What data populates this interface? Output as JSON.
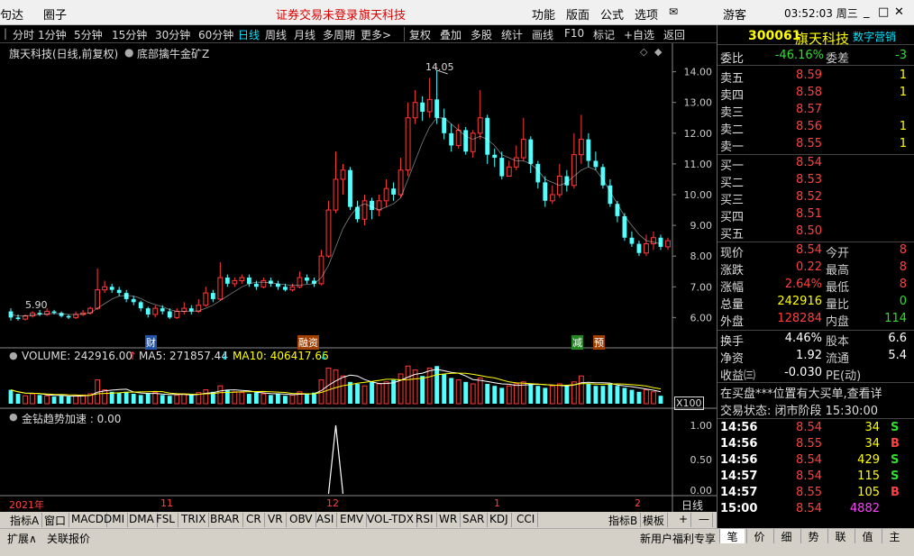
{
  "titlebar": {
    "left_text": "句达",
    "menu1": "圈子",
    "warning": "证券交易未登录",
    "stock": "旗天科技",
    "func": "功能",
    "layout": "版面",
    "formula": "公式",
    "options": "选项",
    "user": "游客",
    "time": "03:52:03 周三",
    "min": "_",
    "restore": "□",
    "close": "✕"
  },
  "toolbar": {
    "items": [
      "分时",
      "1分钟",
      "5分钟",
      "15分钟",
      "30分钟",
      "60分钟",
      "日线",
      "周线",
      "月线",
      "多周期",
      "更多>"
    ],
    "right_items": [
      "复权",
      "叠加",
      "多股",
      "统计",
      "画线",
      "F10",
      "标记",
      "+自选",
      "返回"
    ]
  },
  "chart": {
    "header": "旗天科技(日线,前复权)",
    "indicator": "底部擒牛金矿Z",
    "label_min": "5.90",
    "label_max": "14.05",
    "flags": [
      "财",
      "融资",
      "减",
      "预"
    ],
    "volume_label": "VOLUME: 242916.00",
    "ma5_label": "MA5: 271857.44",
    "ma10_label": "MA10: 406417.66",
    "x100": "X100",
    "indicator2": "金钻趋势加速 : 0.00",
    "x_labels": [
      "2021年",
      "11",
      "12",
      "1",
      "2"
    ],
    "period": "日线"
  },
  "chart_data": {
    "type": "candlestick",
    "ylim": [
      5.6,
      14.4
    ],
    "yticks": [
      6,
      7,
      8,
      9,
      10,
      11,
      12,
      13,
      14
    ],
    "candles": [
      [
        6.2,
        6.0,
        6.3,
        5.9
      ],
      [
        6.0,
        5.95,
        6.1,
        5.9
      ],
      [
        5.95,
        6.05,
        6.1,
        5.9
      ],
      [
        6.05,
        6.15,
        6.2,
        6.0
      ],
      [
        6.15,
        6.1,
        6.25,
        6.05
      ],
      [
        6.1,
        6.2,
        6.3,
        6.05
      ],
      [
        6.2,
        6.15,
        6.25,
        6.1
      ],
      [
        6.15,
        6.05,
        6.2,
        6.0
      ],
      [
        6.05,
        6.0,
        6.1,
        5.95
      ],
      [
        6.0,
        6.1,
        6.2,
        5.95
      ],
      [
        6.1,
        6.15,
        6.25,
        6.05
      ],
      [
        6.15,
        6.3,
        6.35,
        6.1
      ],
      [
        6.3,
        6.9,
        7.6,
        6.25
      ],
      [
        6.9,
        7.0,
        7.2,
        6.8
      ],
      [
        7.0,
        6.9,
        7.1,
        6.8
      ],
      [
        6.9,
        6.8,
        7.0,
        6.7
      ],
      [
        6.8,
        6.6,
        6.9,
        6.5
      ],
      [
        6.6,
        6.5,
        6.7,
        6.4
      ],
      [
        6.5,
        6.3,
        6.55,
        6.2
      ],
      [
        6.3,
        6.1,
        6.35,
        6.0
      ],
      [
        6.1,
        6.3,
        6.4,
        6.0
      ],
      [
        6.3,
        6.2,
        6.4,
        6.1
      ],
      [
        6.2,
        6.0,
        6.3,
        5.95
      ],
      [
        6.0,
        6.2,
        6.3,
        5.95
      ],
      [
        6.2,
        6.3,
        6.5,
        6.1
      ],
      [
        6.3,
        6.2,
        6.4,
        6.1
      ],
      [
        6.2,
        6.4,
        6.6,
        6.15
      ],
      [
        6.4,
        6.8,
        7.0,
        6.35
      ],
      [
        6.8,
        6.6,
        6.9,
        6.5
      ],
      [
        6.6,
        7.3,
        7.8,
        6.55
      ],
      [
        7.3,
        7.1,
        7.4,
        7.0
      ],
      [
        7.1,
        7.2,
        7.3,
        7.0
      ],
      [
        7.2,
        7.3,
        7.4,
        7.1
      ],
      [
        7.3,
        7.1,
        7.4,
        7.0
      ],
      [
        7.1,
        7.0,
        7.2,
        6.9
      ],
      [
        7.0,
        7.2,
        7.3,
        6.95
      ],
      [
        7.2,
        7.1,
        7.3,
        7.0
      ],
      [
        7.1,
        7.0,
        7.2,
        6.9
      ],
      [
        7.0,
        6.9,
        7.1,
        6.85
      ],
      [
        6.9,
        7.0,
        7.1,
        6.85
      ],
      [
        7.0,
        7.3,
        7.5,
        6.95
      ],
      [
        7.3,
        7.2,
        7.4,
        7.1
      ],
      [
        7.2,
        7.1,
        7.3,
        7.0
      ],
      [
        7.1,
        8.0,
        8.2,
        7.05
      ],
      [
        8.0,
        9.5,
        9.8,
        7.95
      ],
      [
        9.5,
        10.5,
        11.4,
        9.4
      ],
      [
        10.5,
        10.8,
        11.0,
        10.0
      ],
      [
        10.8,
        9.6,
        10.9,
        9.5
      ],
      [
        9.6,
        9.2,
        9.8,
        9.1
      ],
      [
        9.2,
        9.8,
        10.0,
        9.0
      ],
      [
        9.8,
        9.5,
        9.9,
        9.2
      ],
      [
        9.5,
        9.8,
        10.0,
        9.3
      ],
      [
        9.8,
        10.2,
        10.5,
        9.6
      ],
      [
        10.2,
        10.0,
        10.4,
        9.8
      ],
      [
        10.0,
        10.8,
        11.2,
        9.9
      ],
      [
        10.8,
        12.5,
        13.0,
        10.6
      ],
      [
        12.5,
        13.0,
        13.4,
        12.3
      ],
      [
        13.0,
        12.7,
        13.2,
        12.4
      ],
      [
        12.7,
        13.1,
        13.8,
        12.5
      ],
      [
        13.1,
        12.5,
        14.05,
        12.3
      ],
      [
        12.5,
        12.0,
        12.8,
        11.8
      ],
      [
        12.0,
        11.6,
        12.3,
        11.4
      ],
      [
        11.6,
        12.1,
        12.3,
        11.5
      ],
      [
        12.1,
        11.4,
        12.2,
        11.3
      ],
      [
        11.4,
        12.0,
        12.1,
        11.2
      ],
      [
        12.0,
        12.5,
        13.4,
        11.8
      ],
      [
        12.5,
        11.3,
        12.6,
        11.0
      ],
      [
        11.3,
        11.2,
        11.5,
        10.9
      ],
      [
        11.2,
        10.6,
        11.4,
        10.5
      ],
      [
        10.6,
        10.9,
        11.1,
        10.6
      ],
      [
        10.9,
        11.2,
        11.6,
        10.8
      ],
      [
        11.2,
        11.8,
        12.5,
        11.1
      ],
      [
        11.8,
        11.0,
        11.9,
        10.7
      ],
      [
        11.0,
        10.4,
        11.1,
        10.2
      ],
      [
        10.4,
        9.8,
        10.6,
        9.6
      ],
      [
        9.8,
        10.0,
        10.3,
        9.7
      ],
      [
        10.0,
        10.6,
        11.0,
        9.9
      ],
      [
        10.6,
        10.3,
        10.8,
        10.1
      ],
      [
        10.3,
        11.3,
        12.0,
        10.2
      ],
      [
        11.3,
        11.8,
        12.6,
        11.0
      ],
      [
        11.8,
        11.1,
        12.0,
        10.9
      ],
      [
        11.1,
        10.9,
        11.4,
        10.8
      ],
      [
        10.9,
        10.3,
        11.0,
        10.2
      ],
      [
        10.3,
        9.7,
        10.5,
        9.6
      ],
      [
        9.7,
        9.3,
        9.8,
        9.1
      ],
      [
        9.3,
        8.6,
        9.4,
        8.5
      ],
      [
        8.6,
        8.4,
        8.8,
        8.3
      ],
      [
        8.4,
        8.1,
        8.5,
        8.0
      ],
      [
        8.1,
        8.4,
        8.7,
        8.0
      ],
      [
        8.4,
        8.6,
        8.8,
        8.2
      ],
      [
        8.6,
        8.3,
        8.7,
        8.2
      ],
      [
        8.3,
        8.5,
        8.6,
        8.2
      ]
    ],
    "ma_price": [
      6.1,
      6.05,
      6.05,
      6.08,
      6.1,
      6.12,
      6.13,
      6.12,
      6.1,
      6.1,
      6.11,
      6.15,
      6.3,
      6.45,
      6.6,
      6.7,
      6.72,
      6.7,
      6.62,
      6.5,
      6.42,
      6.35,
      6.26,
      6.2,
      6.2,
      6.2,
      6.22,
      6.3,
      6.4,
      6.55,
      6.7,
      6.85,
      7.0,
      7.1,
      7.15,
      7.15,
      7.13,
      7.1,
      7.07,
      7.05,
      7.05,
      7.08,
      7.1,
      7.3,
      7.7,
      8.3,
      8.9,
      9.3,
      9.6,
      9.7,
      9.6,
      9.5,
      9.6,
      9.7,
      9.9,
      10.5,
      11.1,
      11.7,
      12.2,
      12.5,
      12.5,
      12.3,
      12.1,
      11.9,
      11.8,
      11.9,
      11.8,
      11.6,
      11.3,
      11.2,
      11.1,
      11.1,
      11.0,
      10.8,
      10.5,
      10.4,
      10.3,
      10.4,
      10.6,
      10.8,
      10.9,
      10.8,
      10.5,
      10.1,
      9.7,
      9.3,
      9.0,
      8.7,
      8.5,
      8.45,
      8.4
    ],
    "volumes": [
      0.35,
      0.25,
      0.2,
      0.25,
      0.22,
      0.2,
      0.18,
      0.2,
      0.18,
      0.2,
      0.22,
      0.25,
      0.6,
      0.35,
      0.3,
      0.28,
      0.3,
      0.25,
      0.22,
      0.25,
      0.28,
      0.22,
      0.2,
      0.22,
      0.25,
      0.22,
      0.28,
      0.35,
      0.3,
      0.45,
      0.35,
      0.3,
      0.28,
      0.25,
      0.28,
      0.25,
      0.22,
      0.25,
      0.2,
      0.22,
      0.3,
      0.25,
      0.28,
      0.6,
      0.9,
      0.85,
      0.7,
      0.55,
      0.5,
      0.45,
      0.55,
      0.5,
      0.55,
      0.6,
      0.75,
      0.95,
      0.85,
      0.7,
      0.9,
      0.95,
      0.75,
      0.65,
      0.6,
      0.55,
      0.5,
      0.65,
      0.5,
      0.45,
      0.4,
      0.45,
      0.5,
      0.55,
      0.5,
      0.45,
      0.4,
      0.45,
      0.5,
      0.45,
      0.55,
      0.7,
      0.5,
      0.45,
      0.45,
      0.5,
      0.45,
      0.4,
      0.35,
      0.3,
      0.35,
      0.3,
      0.2
    ],
    "indicator_spike_index": 45
  },
  "right_panel": {
    "code": "300061",
    "name": "旗天科技",
    "app": "数字营销",
    "weibi": "委比",
    "weibi_val": "-46.16%",
    "weicha": "委差",
    "weicha_val": "-3",
    "asks": [
      {
        "label": "卖五",
        "price": "8.59",
        "vol": "1"
      },
      {
        "label": "卖四",
        "price": "8.58",
        "vol": "1"
      },
      {
        "label": "卖三",
        "price": "8.57",
        "vol": ""
      },
      {
        "label": "卖二",
        "price": "8.56",
        "vol": "1"
      },
      {
        "label": "卖一",
        "price": "8.55",
        "vol": "1"
      }
    ],
    "bids": [
      {
        "label": "买一",
        "price": "8.54",
        "vol": ""
      },
      {
        "label": "买二",
        "price": "8.53",
        "vol": ""
      },
      {
        "label": "买三",
        "price": "8.52",
        "vol": ""
      },
      {
        "label": "买四",
        "price": "8.51",
        "vol": ""
      },
      {
        "label": "买五",
        "price": "8.50",
        "vol": ""
      }
    ],
    "stats": [
      {
        "l1": "现价",
        "v1": "8.54",
        "c1": "red",
        "l2": "今开",
        "v2": "8",
        "c2": "red"
      },
      {
        "l1": "涨跌",
        "v1": "0.22",
        "c1": "red",
        "l2": "最高",
        "v2": "8",
        "c2": "red"
      },
      {
        "l1": "涨幅",
        "v1": "2.64%",
        "c1": "red",
        "l2": "最低",
        "v2": "8",
        "c2": "red"
      },
      {
        "l1": "总量",
        "v1": "242916",
        "c1": "yellow",
        "l2": "量比",
        "v2": "0",
        "c2": "green"
      },
      {
        "l1": "外盘",
        "v1": "128284",
        "c1": "red",
        "l2": "内盘",
        "v2": "114",
        "c2": "green"
      }
    ],
    "stats2": [
      {
        "l1": "换手",
        "v1": "4.46%",
        "l2": "股本",
        "v2": "6.6"
      },
      {
        "l1": "净资",
        "v1": "1.92",
        "l2": "流通",
        "v2": "5.4"
      },
      {
        "l1": "收益㈢",
        "v1": "-0.030",
        "l2": "PE(动)",
        "v2": ""
      }
    ],
    "notice": "在买盘***位置有大买单,查看详",
    "trade_status": "交易状态: 闭市阶段 15:30:00",
    "ticks": [
      {
        "t": "14:56",
        "p": "8.54",
        "v": "34",
        "s": "S",
        "pc": "red",
        "sc": "green"
      },
      {
        "t": "14:56",
        "p": "8.55",
        "v": "34",
        "s": "B",
        "pc": "red",
        "sc": "red"
      },
      {
        "t": "14:56",
        "p": "8.54",
        "v": "429",
        "s": "S",
        "pc": "red",
        "sc": "green"
      },
      {
        "t": "14:57",
        "p": "8.54",
        "v": "115",
        "s": "S",
        "pc": "red",
        "sc": "green"
      },
      {
        "t": "14:57",
        "p": "8.55",
        "v": "105",
        "s": "B",
        "pc": "red",
        "sc": "red"
      },
      {
        "t": "15:00",
        "p": "8.54",
        "v": "4882",
        "s": "",
        "pc": "red",
        "sc": "red"
      }
    ]
  },
  "tabs": [
    "指标A",
    "窗口",
    "MACD",
    "DMI",
    "DMA",
    "FSL",
    "TRIX",
    "BRAR",
    "CR",
    "VR",
    "OBV",
    "ASI",
    "EMV",
    "VOL-TDX",
    "RSI",
    "WR",
    "SAR",
    "KDJ",
    "CCI"
  ],
  "tabs_right": [
    "指标B",
    "模板",
    "+",
    "—"
  ],
  "statusbar": {
    "expand": "扩展∧",
    "related": "关联报价",
    "promo": "新用户福利专享",
    "rtabs": [
      "笔",
      "价",
      "细",
      "势",
      "联",
      "值",
      "主"
    ]
  }
}
